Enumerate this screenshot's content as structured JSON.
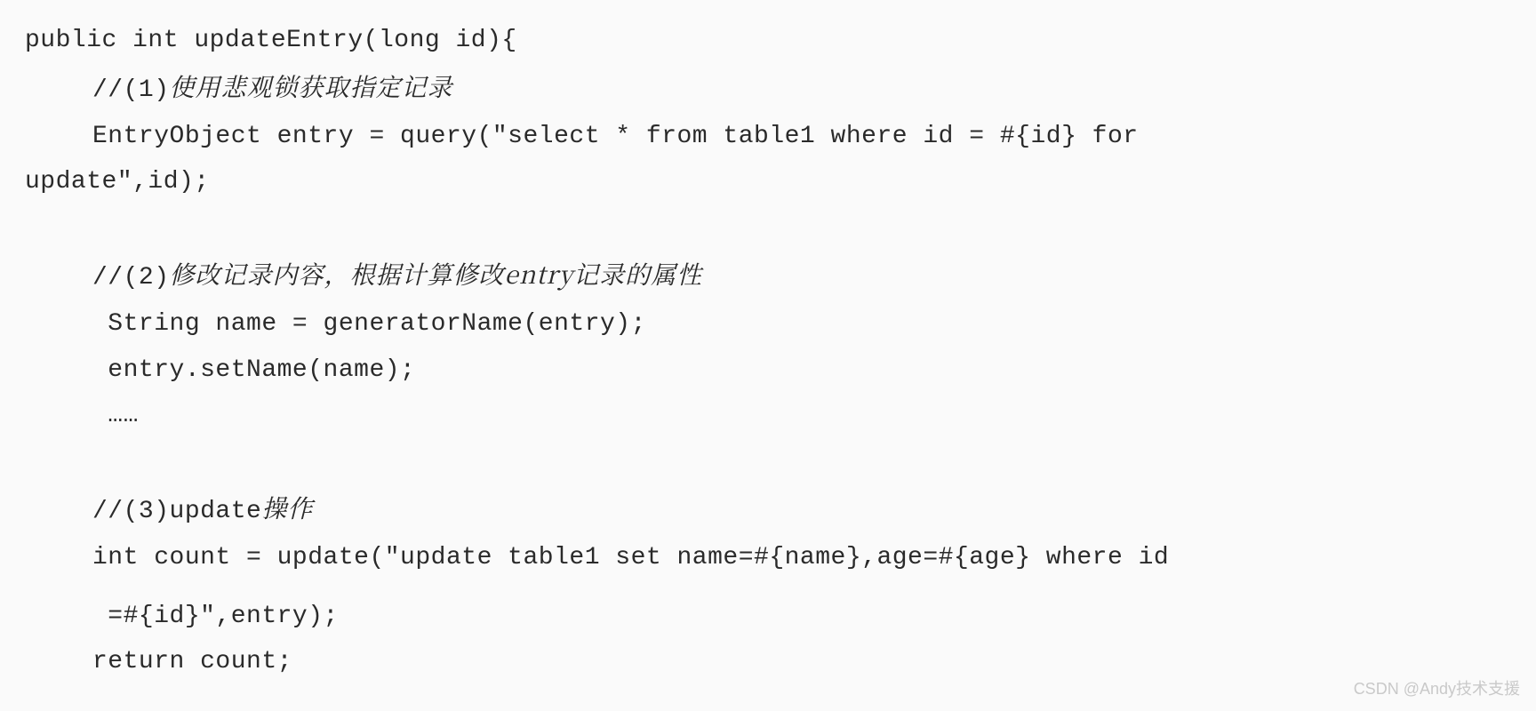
{
  "code": {
    "line1": "public int updateEntry(long id){",
    "comment1_prefix": "//(1)",
    "comment1_text": "使用悲观锁获取指定记录",
    "line3": "EntryObject entry = query(\"select * from table1 where id = #{id} for",
    "line4": "update\",id);",
    "comment2_prefix": "//(2)",
    "comment2_text": "修改记录内容，根据计算修改entry记录的属性",
    "line6": " String name = generatorName(entry);",
    "line7": " entry.setName(name);",
    "line8": " ……",
    "comment3_prefix": "//(3)update",
    "comment3_text": "操作",
    "line10": "int count = update(\"update table1 set name=#{name},age=#{age} where id",
    "line11": " =#{id}\",entry);",
    "line12": "return count;"
  },
  "watermark": "CSDN @Andy技术支援"
}
